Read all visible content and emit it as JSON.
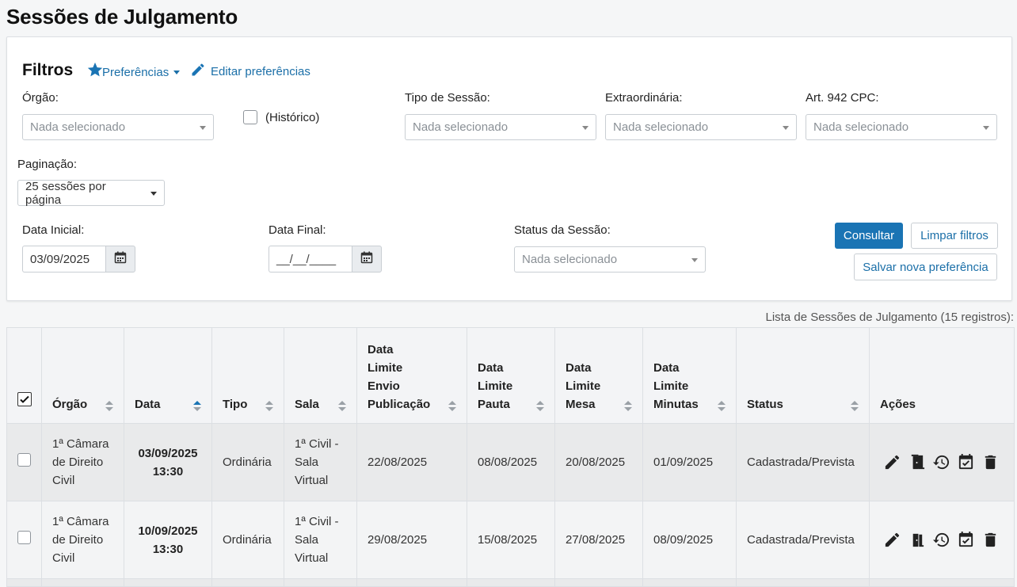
{
  "page": {
    "title": "Sessões de Julgamento"
  },
  "filters": {
    "title": "Filtros",
    "preferences_label": "Preferências",
    "edit_preferences_label": "Editar preferências",
    "orgao": {
      "label": "Órgão:",
      "placeholder": "Nada selecionado"
    },
    "historico_label": "(Histórico)",
    "tipo_sessao": {
      "label": "Tipo de Sessão:",
      "placeholder": "Nada selecionado"
    },
    "extraordinaria": {
      "label": "Extraordinária:",
      "placeholder": "Nada selecionado"
    },
    "art942": {
      "label": "Art. 942 CPC:",
      "placeholder": "Nada selecionado"
    },
    "paginacao": {
      "label": "Paginação:",
      "value": "25 sessões por página"
    },
    "data_inicial": {
      "label": "Data Inicial:",
      "value": "03/09/2025"
    },
    "data_final": {
      "label": "Data Final:",
      "value": "__/__/____"
    },
    "status_sessao": {
      "label": "Status da Sessão:",
      "placeholder": "Nada selecionado"
    },
    "consultar_label": "Consultar",
    "limpar_label": "Limpar filtros",
    "salvar_label": "Salvar nova preferência"
  },
  "list": {
    "caption": "Lista de Sessões de Julgamento (15 registros):",
    "columns": {
      "orgao": "Órgão",
      "data": "Data",
      "tipo": "Tipo",
      "sala": "Sala",
      "envio_l1": "Data",
      "envio_l2": "Limite",
      "envio_l3": "Envio",
      "envio_l4": "Publicação",
      "pauta_l1": "Data",
      "pauta_l2": "Limite",
      "pauta_l3": "Pauta",
      "mesa_l1": "Data",
      "mesa_l2": "Limite",
      "mesa_l3": "Mesa",
      "minutas_l1": "Data",
      "minutas_l2": "Limite",
      "minutas_l3": "Minutas",
      "status": "Status",
      "acoes": "Ações"
    },
    "rows": [
      {
        "orgao_l1": "1ª Câmara",
        "orgao_l2": "de Direito",
        "orgao_l3": "Civil",
        "data_l1": "03/09/2025",
        "data_l2": "13:30",
        "tipo": "Ordinária",
        "sala_l1": "1ª Civil -",
        "sala_l2": "Sala",
        "sala_l3": "Virtual",
        "envio": "22/08/2025",
        "pauta": "08/08/2025",
        "mesa": "20/08/2025",
        "minutas": "01/09/2025",
        "status": "Cadastrada/Prevista"
      },
      {
        "orgao_l1": "1ª Câmara",
        "orgao_l2": "de Direito",
        "orgao_l3": "Civil",
        "data_l1": "10/09/2025",
        "data_l2": "13:30",
        "tipo": "Ordinária",
        "sala_l1": "1ª Civil -",
        "sala_l2": "Sala",
        "sala_l3": "Virtual",
        "envio": "29/08/2025",
        "pauta": "15/08/2025",
        "mesa": "27/08/2025",
        "minutas": "08/09/2025",
        "status": "Cadastrada/Prevista"
      }
    ]
  },
  "colors": {
    "accent": "#1a74b4",
    "link": "#1b6fa8"
  }
}
